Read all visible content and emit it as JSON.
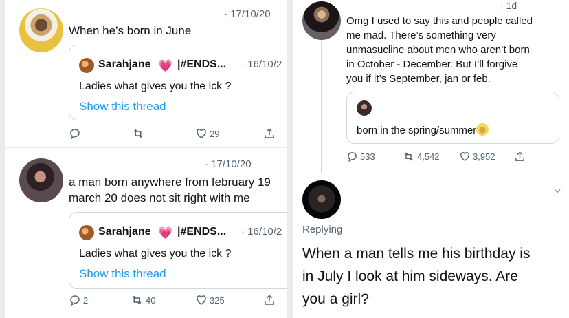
{
  "left": {
    "tweet1": {
      "date": "· 17/10/20",
      "text": "When he’s born in June",
      "quote": {
        "name": "Sarahjane",
        "handle": "|#ENDS...",
        "date": "· 16/10/2",
        "text": "Ladies what gives you the ick ?",
        "link": "Show this thread"
      },
      "actions": {
        "retweets": "",
        "likes": "29"
      }
    },
    "tweet2": {
      "date": "· 17/10/20",
      "text_line1": "a man born anywhere from february 19",
      "text_line2": "march 20 does not sit right with me",
      "quote": {
        "name": "Sarahjane",
        "handle": "|#ENDS...",
        "date": "· 16/10/2",
        "text": "Ladies what gives you the ick ?",
        "link": "Show this thread"
      },
      "actions": {
        "replies": "2",
        "retweets": "40",
        "likes": "325"
      }
    }
  },
  "right": {
    "tweet1": {
      "date": "· 1d",
      "lines": [
        "Omg I used to say this and people called",
        "me mad. There’s something very",
        "unmasucline about men who aren’t born",
        "in October - December. But I’ll forgive",
        "you if it’s September, jan or feb."
      ],
      "quote": {
        "text": "born in the spring/summer"
      },
      "actions": {
        "replies": "533",
        "retweets": "4,542",
        "likes": "3,952"
      }
    },
    "tweet2": {
      "replying": "Replying",
      "lines": [
        "When a man tells me his birthday is",
        "in July I look at him sideways. Are",
        "you a girl?"
      ]
    }
  }
}
